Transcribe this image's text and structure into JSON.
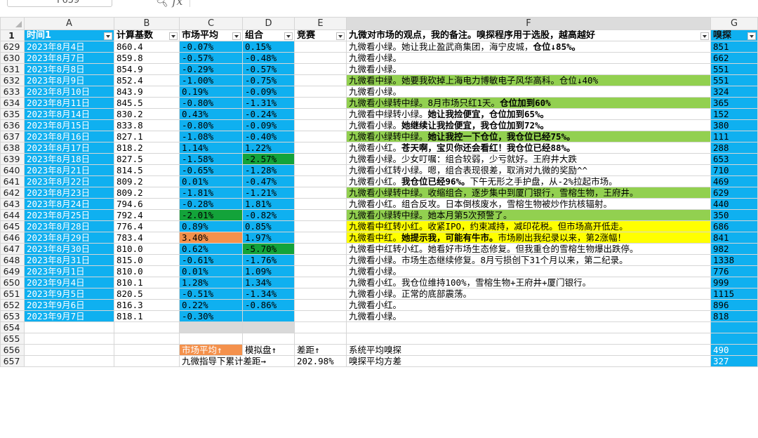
{
  "name_box": "F659",
  "formula_icon": "fx",
  "columns": [
    "A",
    "B",
    "C",
    "D",
    "E",
    "F",
    "G"
  ],
  "header_row": {
    "row": "1",
    "cells": [
      "时间1",
      "计算基数",
      "市场平均",
      "组合",
      "竞赛",
      "九微对市场的观点，我的备注。嗅探程序用于选股，越高越好",
      "嗅探"
    ]
  },
  "rows": [
    {
      "n": "629",
      "date": "2023年8月4日",
      "base": "860.4",
      "mkt": "-0.07%",
      "port": "0.15%",
      "note": "九微看小绿。她让我止盈武商集团，海宁皮城，",
      "bold": "仓位↓85%。",
      "sniff": "851"
    },
    {
      "n": "630",
      "date": "2023年8月7日",
      "base": "859.8",
      "mkt": "-0.57%",
      "port": "-0.48%",
      "note": "九微看小绿。",
      "bold": "",
      "sniff": "662"
    },
    {
      "n": "631",
      "date": "2023年8月8日",
      "base": "854.9",
      "mkt": "-0.29%",
      "port": "-0.57%",
      "note": "九微看小绿。",
      "bold": "",
      "sniff": "551"
    },
    {
      "n": "632",
      "date": "2023年8月9日",
      "base": "852.4",
      "mkt": "-1.00%",
      "port": "-0.75%",
      "note": "九微看中绿。她要我砍掉上海电力博敏电子风华高科。仓位↓40%",
      "bold": "",
      "sniff": "551"
    },
    {
      "n": "633",
      "date": "2023年8月10日",
      "base": "843.9",
      "mkt": "0.19%",
      "port": "-0.09%",
      "note": "九微看小绿。",
      "bold": "",
      "sniff": "324"
    },
    {
      "n": "634",
      "date": "2023年8月11日",
      "base": "845.5",
      "mkt": "-0.80%",
      "port": "-1.31%",
      "note": "九微看小绿转中绿。8月市场只红1天。",
      "bold": "仓位加到60%",
      "sniff": "365"
    },
    {
      "n": "635",
      "date": "2023年8月14日",
      "base": "830.2",
      "mkt": "0.43%",
      "port": "-0.24%",
      "note": "九微看中绿转小绿。",
      "bold": "她让我捡便宜，仓位加到65%。",
      "sniff": "152"
    },
    {
      "n": "636",
      "date": "2023年8月15日",
      "base": "833.8",
      "mkt": "-0.80%",
      "port": "-0.09%",
      "note": "九微看小绿。",
      "bold": "她继续让我捡便宜，我仓位加到72%。",
      "sniff": "380"
    },
    {
      "n": "637",
      "date": "2023年8月16日",
      "base": "827.1",
      "mkt": "-1.08%",
      "port": "-0.40%",
      "note": "九微看小绿转中绿。",
      "bold": "她让我控一下仓位，我仓位已经75%。",
      "sniff": "111"
    },
    {
      "n": "638",
      "date": "2023年8月17日",
      "base": "818.2",
      "mkt": "1.14%",
      "port": "1.22%",
      "note": "九微看小红。",
      "bold": "苍天啊，宝贝你还会看红！我仓位已经88%。",
      "sniff": "288"
    },
    {
      "n": "639",
      "date": "2023年8月18日",
      "base": "827.5",
      "mkt": "-1.58%",
      "port": "-2.57%",
      "note": "九微看小绿。少女叮嘱：组合较弱，少亏就好。王府井大跌",
      "bold": "",
      "sniff": "653"
    },
    {
      "n": "640",
      "date": "2023年8月21日",
      "base": "814.5",
      "mkt": "-0.65%",
      "port": "-1.28%",
      "note": "九微看小红转小绿。嗯，组合表现很差，取消对九微的奖励^^",
      "bold": "",
      "sniff": "710"
    },
    {
      "n": "641",
      "date": "2023年8月22日",
      "base": "809.2",
      "mkt": "0.01%",
      "port": "-0.47%",
      "note": "九微看小红。",
      "bold": "我仓位已经96%。",
      "tail": "下午无形之手护盘，从-2%拉起市场。",
      "sniff": "469"
    },
    {
      "n": "642",
      "date": "2023年8月23日",
      "base": "809.2",
      "mkt": "-1.81%",
      "port": "-1.21%",
      "note": "九微看小绿转中绿。收缩组合，逐步集中到厦门银行，雪榕生物，王府井。",
      "bold": "",
      "sniff": "629"
    },
    {
      "n": "643",
      "date": "2023年8月24日",
      "base": "794.6",
      "mkt": "-0.28%",
      "port": "1.81%",
      "note": "九微看小红。组合反攻。日本倒核废水，雪榕生物被炒作抗核辐射。",
      "bold": "",
      "sniff": "440"
    },
    {
      "n": "644",
      "date": "2023年8月25日",
      "base": "792.4",
      "mkt": "-2.01%",
      "port": "-0.82%",
      "note": "九微看小绿转中绿。她本月第5次预警了。",
      "bold": "",
      "sniff": "350"
    },
    {
      "n": "645",
      "date": "2023年8月28日",
      "base": "776.4",
      "mkt": "0.89%",
      "port": "0.85%",
      "note": "九微看中红转小红。收紧IPO，约束减持，减印花税。但市场高开低走。",
      "bold": "",
      "sniff": "686"
    },
    {
      "n": "646",
      "date": "2023年8月29日",
      "base": "783.4",
      "mkt": "3.40%",
      "port": "1.97%",
      "note": "九微看中红。",
      "bold": "她提示我，可能有牛市。",
      "tail": "市场刷出我纪录以来，第2涨幅！",
      "sniff": "841"
    },
    {
      "n": "647",
      "date": "2023年8月30日",
      "base": "810.0",
      "mkt": "0.62%",
      "port": "-5.70%",
      "note": "九微看中红转小红。她看好市场生态修复。但我重仓的雪榕生物爆出跌停。",
      "bold": "",
      "sniff": "982"
    },
    {
      "n": "648",
      "date": "2023年8月31日",
      "base": "815.0",
      "mkt": "-0.61%",
      "port": "-1.76%",
      "note": "九微看小绿。市场生态继续修复。8月亏损创下31个月以来，第二纪录。",
      "bold": "",
      "sniff": "1338"
    },
    {
      "n": "649",
      "date": "2023年9月1日",
      "base": "810.0",
      "mkt": "0.01%",
      "port": "1.09%",
      "note": "九微看小绿。",
      "bold": "",
      "sniff": "776"
    },
    {
      "n": "650",
      "date": "2023年9月4日",
      "base": "810.1",
      "mkt": "1.28%",
      "port": "1.34%",
      "note": "九微看小红。我仓位维持100%，雪榕生物+王府井+厦门银行。",
      "bold": "",
      "sniff": "999"
    },
    {
      "n": "651",
      "date": "2023年9月5日",
      "base": "820.5",
      "mkt": "-0.51%",
      "port": "-1.34%",
      "note": "九微看小绿。正常的底部震荡。",
      "bold": "",
      "sniff": "1115"
    },
    {
      "n": "652",
      "date": "2023年9月6日",
      "base": "816.3",
      "mkt": "0.22%",
      "port": "-0.86%",
      "note": "九微看小红。",
      "bold": "",
      "sniff": "896"
    },
    {
      "n": "653",
      "date": "2023年9月7日",
      "base": "818.1",
      "mkt": "-0.30%",
      "port": "",
      "note": "九微看小绿。",
      "bold": "",
      "sniff": "818"
    }
  ],
  "empty_rows": [
    "654",
    "655"
  ],
  "row656": {
    "n": "656",
    "c": "市场平均↑",
    "d": "模拟盘↑",
    "e": "差距↑",
    "f": "系统平均嗅探",
    "g": "490"
  },
  "row657": {
    "n": "657",
    "cd": "九微指导下累计差距→",
    "e": "202.98%",
    "f": "嗅探平均方差",
    "g": "327"
  }
}
